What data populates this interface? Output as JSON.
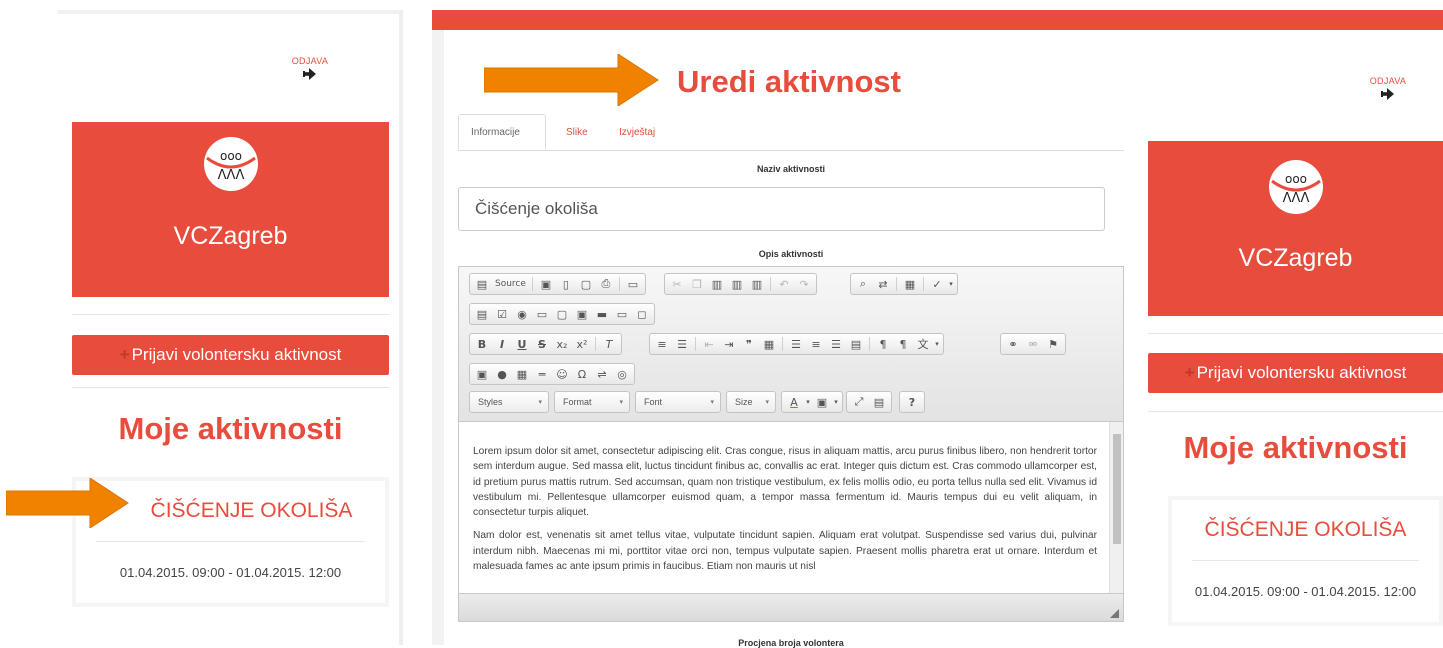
{
  "logout_label": "ODJAVA",
  "org_name": "VCZagreb",
  "register_button": "Prijavi volontersku aktivnost",
  "my_activities_title": "Moje aktivnosti",
  "activity": {
    "title": "ČIŠĆENJE OKOLIŠA",
    "dates": "01.04.2015. 09:00 - 01.04.2015. 12:00"
  },
  "edit": {
    "page_title": "Uredi aktivnost",
    "tabs": [
      "Informacije",
      "Slike",
      "Izvještaj"
    ],
    "name_label": "Naziv aktivnosti",
    "name_value": "Čišćenje okoliša",
    "desc_label": "Opis aktivnosti",
    "source_label": "Source",
    "combos": [
      "Styles",
      "Format",
      "Font",
      "Size"
    ],
    "paragraphs": [
      "Lorem ipsum dolor sit amet, consectetur adipiscing elit. Cras congue, risus in aliquam mattis, arcu purus finibus libero, non hendrerit tortor sem interdum augue. Sed massa elit, luctus tincidunt finibus ac, convallis ac erat. Integer quis dictum est. Cras commodo ullamcorper est, id pretium purus mattis rutrum. Sed accumsan, quam non tristique vestibulum, ex felis mollis odio, eu porta tellus nulla sed elit. Vivamus id vestibulum mi. Pellentesque ullamcorper euismod quam, a tempor massa fermentum id. Mauris tempus dui eu velit aliquam, in consectetur turpis aliquet.",
      "Nam dolor est, venenatis sit amet tellus vitae, vulputate tincidunt sapien. Aliquam erat volutpat. Suspendisse sed varius dui, pulvinar interdum nibh. Maecenas mi mi, porttitor vitae orci non, tempus vulputate sapien. Praesent mollis pharetra erat ut ornare. Interdum et malesuada fames ac ante ipsum primis in faucibus. Etiam non mauris ut nisl"
    ],
    "volunteers_label": "Procjena broja volontera"
  },
  "colors": {
    "accent": "#e74c3c",
    "arrow": "#f08200"
  }
}
